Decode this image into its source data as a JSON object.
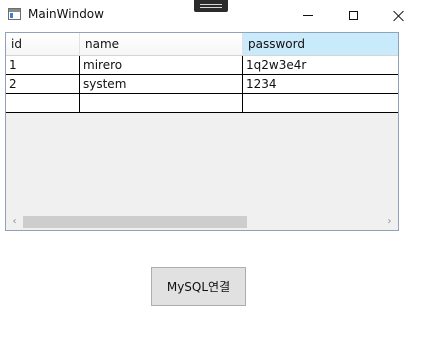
{
  "window": {
    "title": "MainWindow",
    "icons": {
      "app": "app-window-icon",
      "minimize": "minimize-icon",
      "maximize": "maximize-icon",
      "close": "close-icon"
    }
  },
  "grid": {
    "columns": [
      "id",
      "name",
      "password"
    ],
    "selected_column": "password",
    "rows": [
      {
        "id": "1",
        "name": "mirero",
        "password": "1q2w3e4r"
      },
      {
        "id": "2",
        "name": "system",
        "password": "1234"
      },
      {
        "id": "",
        "name": "",
        "password": ""
      }
    ],
    "scrollbar": {
      "left_arrow": "‹",
      "right_arrow": "›"
    }
  },
  "actions": {
    "connect_label": "MySQL연결"
  },
  "colors": {
    "header_selected": "#c9eafa",
    "grid_border": "#8ea2ba",
    "button_bg": "#e1e1e1"
  }
}
